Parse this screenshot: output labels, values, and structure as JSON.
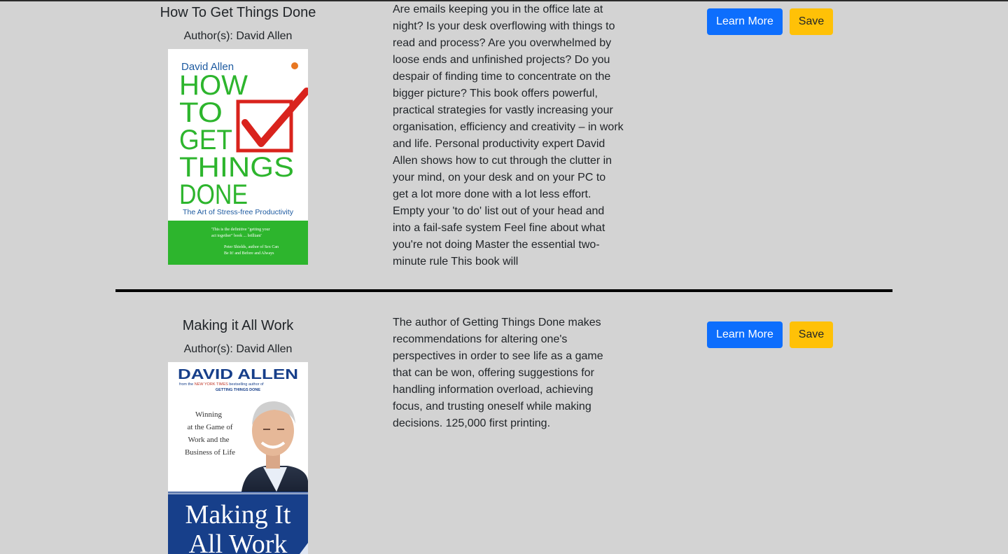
{
  "books": [
    {
      "title": "How To Get Things Done",
      "authors": "Author(s): David Allen",
      "description": "Are emails keeping you in the office late at night? Is your desk overflowing with things to read and process? Are you overwhelmed by loose ends and unfinished projects? Do you despair of finding time to concentrate on the bigger picture? This book offers powerful, practical strategies for vastly increasing your organisation, efficiency and creativity – in work and life. Personal productivity expert David Allen shows how to cut through the clutter in your mind, on your desk and on your PC to get a lot more done with a lot less effort. Empty your 'to do' list out of your head and into a fail-safe system Feel fine about what you're not doing Master the essential two-minute rule This book will",
      "learn_more_label": "Learn More",
      "save_label": "Save",
      "cover": {
        "author": "David Allen",
        "title_lines": [
          "HOW",
          "TO",
          "GET",
          "THINGS",
          "DONE"
        ],
        "subtitle": "The Art of Stress-free Productivity",
        "quote_line1": "'This is the definitive \"getting your",
        "quote_line2": "act together\" book ... brilliant'",
        "quote_attr1": "Peter Shields, author of Sex Can",
        "quote_attr2": "Be It! and Before and Always",
        "colors": {
          "green": "#2db52d",
          "red": "#d9231d",
          "blue": "#1d5aa0"
        }
      }
    },
    {
      "title": "Making it All Work",
      "authors": "Author(s): David Allen",
      "description": "The author of Getting Things Done makes recommendations for altering one's perspectives in order to see life as a game that can be won, offering suggestions for handling information overload, achieving focus, and trusting oneself while making decisions. 125,000 first printing.",
      "learn_more_label": "Learn More",
      "save_label": "Save",
      "cover": {
        "author": "DAVID ALLEN",
        "tagline_prefix": "from the",
        "tagline_highlight": "NEW YORK TIMES",
        "tagline_suffix": "bestselling author of",
        "tagline_book": "GETTING THINGS DONE",
        "subtitle_lines": [
          "Winning",
          "at the Game of",
          "Work and the",
          "Business of Life"
        ],
        "title_lines": [
          "Making It",
          "All Work"
        ],
        "colors": {
          "navy": "#173f8a",
          "red": "#c0392b"
        }
      }
    }
  ],
  "colors": {
    "page_bg": "#d3d3d3",
    "learn_more": "#0d6efd",
    "save": "#ffc107",
    "divider": "#000000"
  }
}
